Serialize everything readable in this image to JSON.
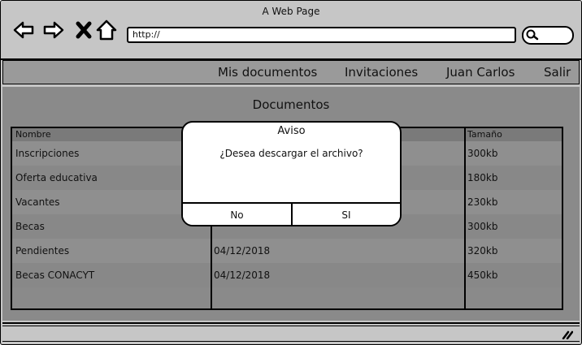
{
  "window": {
    "title": "A Web Page"
  },
  "address_bar": {
    "url": "http://"
  },
  "nav": {
    "items": [
      "Mis documentos",
      "Invitaciones",
      "Juan Carlos",
      "Salir"
    ]
  },
  "page": {
    "title": "Documentos"
  },
  "table": {
    "headers": {
      "name": "Nombre",
      "size": "Tamaño"
    },
    "rows": [
      {
        "name": "Inscripciones",
        "date": "",
        "size": "300kb"
      },
      {
        "name": "Oferta educativa",
        "date": "",
        "size": "180kb"
      },
      {
        "name": "Vacantes",
        "date": "",
        "size": "230kb"
      },
      {
        "name": "Becas",
        "date": "",
        "size": "300kb"
      },
      {
        "name": "Pendientes",
        "date": "04/12/2018",
        "size": "320kb"
      },
      {
        "name": "Becas CONACYT",
        "date": "04/12/2018",
        "size": "450kb"
      }
    ]
  },
  "dialog": {
    "title": "Aviso",
    "message": "¿Desea descargar el archivo?",
    "no_label": "No",
    "yes_label": "SI"
  },
  "icons": [
    "back-arrow-icon",
    "forward-arrow-icon",
    "close-x-icon",
    "home-icon",
    "search-icon",
    "resize-grip-icon"
  ]
}
